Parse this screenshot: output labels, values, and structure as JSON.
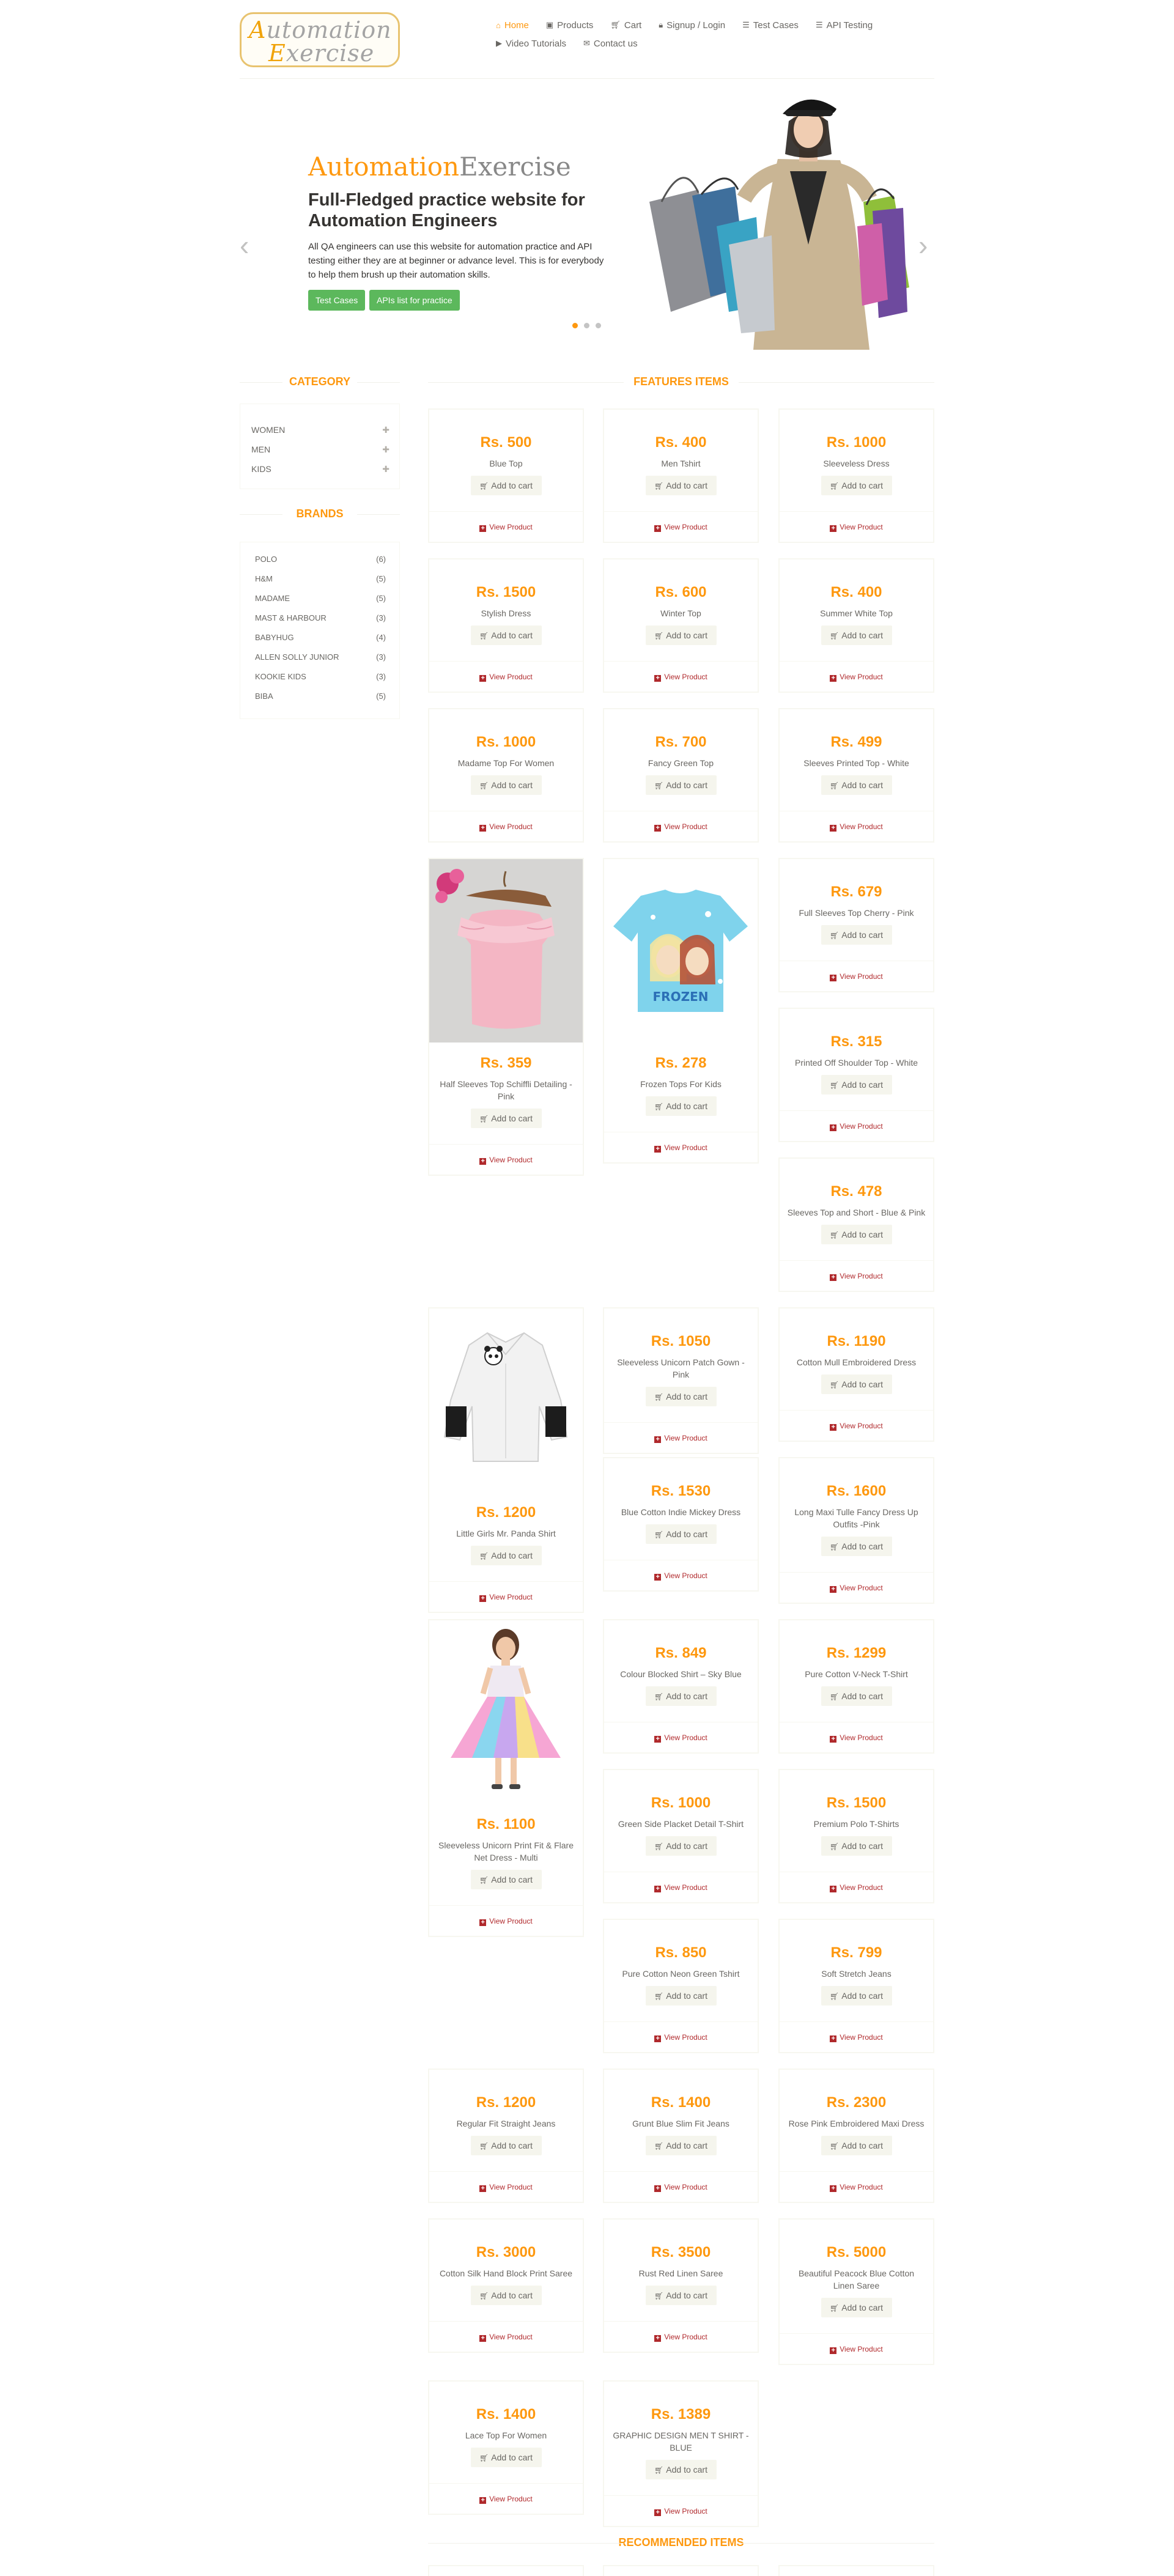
{
  "header": {
    "logo_text": "Automation Exercise",
    "nav": [
      {
        "label": "Home",
        "icon": "home-icon"
      },
      {
        "label": "Products",
        "icon": "products-icon"
      },
      {
        "label": "Cart",
        "icon": "cart-icon"
      },
      {
        "label": "Signup / Login",
        "icon": "lock-icon"
      },
      {
        "label": "Test Cases",
        "icon": "list-icon"
      },
      {
        "label": "API Testing",
        "icon": "list-icon"
      },
      {
        "label": "Video Tutorials",
        "icon": "youtube-icon"
      },
      {
        "label": "Contact us",
        "icon": "envelope-icon"
      }
    ]
  },
  "slider": {
    "title_a": "Automation",
    "title_b": "Exercise",
    "subtitle": "Full-Fledged practice website for Automation Engineers",
    "description": "All QA engineers can use this website for automation practice and API testing either they are at beginner or advance level. This is for everybody to help them brush up their automation skills.",
    "btn_test_cases": "Test Cases",
    "btn_apis": "APIs list for practice",
    "active_slide": 1
  },
  "sidebar": {
    "category_title": "CATEGORY",
    "categories": [
      {
        "label": "WOMEN"
      },
      {
        "label": "MEN"
      },
      {
        "label": "KIDS"
      }
    ],
    "brands_title": "BRANDS",
    "brands": [
      {
        "name": "POLO",
        "count": "(6)"
      },
      {
        "name": "H&M",
        "count": "(5)"
      },
      {
        "name": "MADAME",
        "count": "(5)"
      },
      {
        "name": "MAST & HARBOUR",
        "count": "(3)"
      },
      {
        "name": "BABYHUG",
        "count": "(4)"
      },
      {
        "name": "ALLEN SOLLY JUNIOR",
        "count": "(3)"
      },
      {
        "name": "KOOKIE KIDS",
        "count": "(3)"
      },
      {
        "name": "BIBA",
        "count": "(5)"
      }
    ]
  },
  "features": {
    "title": "FEATURES ITEMS",
    "add_label": "Add to cart",
    "view_label": "View Product",
    "items": [
      {
        "price": "Rs. 500",
        "name": "Blue Top",
        "image": "none"
      },
      {
        "price": "Rs. 400",
        "name": "Men Tshirt",
        "image": "none"
      },
      {
        "price": "Rs. 1000",
        "name": "Sleeveless Dress",
        "image": "none"
      },
      {
        "price": "Rs. 1500",
        "name": "Stylish Dress",
        "image": "none"
      },
      {
        "price": "Rs. 600",
        "name": "Winter Top",
        "image": "none"
      },
      {
        "price": "Rs. 400",
        "name": "Summer White Top",
        "image": "none"
      },
      {
        "price": "Rs. 1000",
        "name": "Madame Top For Women",
        "image": "none"
      },
      {
        "price": "Rs. 700",
        "name": "Fancy Green Top",
        "image": "none"
      },
      {
        "price": "Rs. 499",
        "name": "Sleeves Printed Top - White",
        "image": "none"
      },
      {
        "price": "Rs. 359",
        "name": "Half Sleeves Top Schiffli Detailing - Pink",
        "image": "pink-top"
      },
      {
        "price": "Rs. 278",
        "name": "Frozen Tops For Kids",
        "image": "frozen-top"
      },
      {
        "price": "Rs. 679",
        "name": "Full Sleeves Top Cherry - Pink",
        "image": "none"
      },
      {
        "price": "Rs. 315",
        "name": "Printed Off Shoulder Top - White",
        "image": "none"
      },
      {
        "price": "Rs. 478",
        "name": "Sleeves Top and Short - Blue & Pink",
        "image": "none"
      },
      {
        "price": "Rs. 1200",
        "name": "Little Girls Mr. Panda Shirt",
        "image": "panda-shirt"
      },
      {
        "price": "Rs. 1050",
        "name": "Sleeveless Unicorn Patch Gown - Pink",
        "image": "none"
      },
      {
        "price": "Rs. 1190",
        "name": "Cotton Mull Embroidered Dress",
        "image": "none"
      },
      {
        "price": "Rs. 1530",
        "name": "Blue Cotton Indie Mickey Dress",
        "image": "none"
      },
      {
        "price": "Rs. 1600",
        "name": "Long Maxi Tulle Fancy Dress Up Outfits -Pink",
        "image": "none"
      },
      {
        "price": "Rs. 1100",
        "name": "Sleeveless Unicorn Print Fit & Flare Net Dress - Multi",
        "image": "unicorn-dress"
      },
      {
        "price": "Rs. 849",
        "name": "Colour Blocked Shirt – Sky Blue",
        "image": "none"
      },
      {
        "price": "Rs. 1299",
        "name": "Pure Cotton V-Neck T-Shirt",
        "image": "none"
      },
      {
        "price": "Rs. 1000",
        "name": "Green Side Placket Detail T-Shirt",
        "image": "none"
      },
      {
        "price": "Rs. 1500",
        "name": "Premium Polo T-Shirts",
        "image": "none"
      },
      {
        "price": "Rs. 850",
        "name": "Pure Cotton Neon Green Tshirt",
        "image": "none"
      },
      {
        "price": "Rs. 799",
        "name": "Soft Stretch Jeans",
        "image": "none"
      },
      {
        "price": "Rs. 1200",
        "name": "Regular Fit Straight Jeans",
        "image": "none"
      },
      {
        "price": "Rs. 1400",
        "name": "Grunt Blue Slim Fit Jeans",
        "image": "none"
      },
      {
        "price": "Rs. 2300",
        "name": "Rose Pink Embroidered Maxi Dress",
        "image": "none"
      },
      {
        "price": "Rs. 3000",
        "name": "Cotton Silk Hand Block Print Saree",
        "image": "none"
      },
      {
        "price": "Rs. 3500",
        "name": "Rust Red Linen Saree",
        "image": "none"
      },
      {
        "price": "Rs. 5000",
        "name": "Beautiful Peacock Blue Cotton Linen Saree",
        "image": "none"
      },
      {
        "price": "Rs. 1400",
        "name": "Lace Top For Women",
        "image": "none"
      },
      {
        "price": "Rs. 1389",
        "name": "GRAPHIC DESIGN MEN T SHIRT - BLUE",
        "image": "none"
      }
    ]
  },
  "recommended": {
    "title": "RECOMMENDED ITEMS"
  },
  "colors": {
    "accent": "#fe980f",
    "button_green": "#5cb85c",
    "view_red": "#b0292c"
  }
}
